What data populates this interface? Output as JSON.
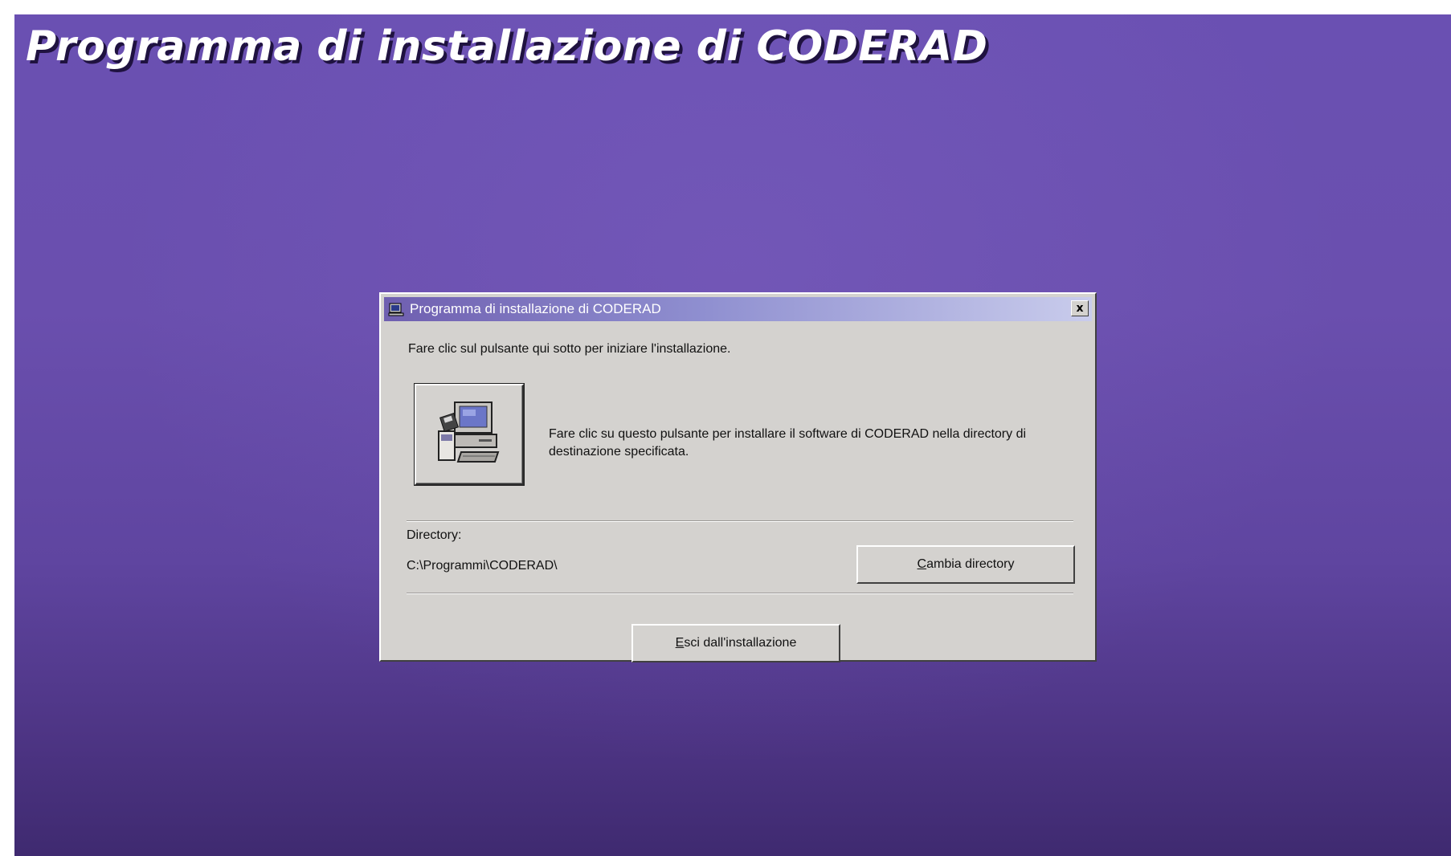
{
  "banner": {
    "title": "Programma di installazione di CODERAD"
  },
  "dialog": {
    "title": "Programma di installazione di CODERAD",
    "close_label": "x",
    "instruction": "Fare clic sul pulsante qui sotto per iniziare l'installazione.",
    "install_button_icon": "computer-setup-icon",
    "install_description": "Fare clic su questo pulsante per installare il software di CODERAD nella directory di destinazione specificata.",
    "directory_label": "Directory:",
    "directory_path": "C:\\Programmi\\CODERAD\\",
    "change_directory_label": "Cambia directory",
    "exit_label": "Esci dall'installazione"
  },
  "colors": {
    "desktop_background": "#6a50b2",
    "dialog_face": "#d4d2cf",
    "titlebar_start": "#6f5fb0",
    "titlebar_end": "#c9ccec"
  }
}
